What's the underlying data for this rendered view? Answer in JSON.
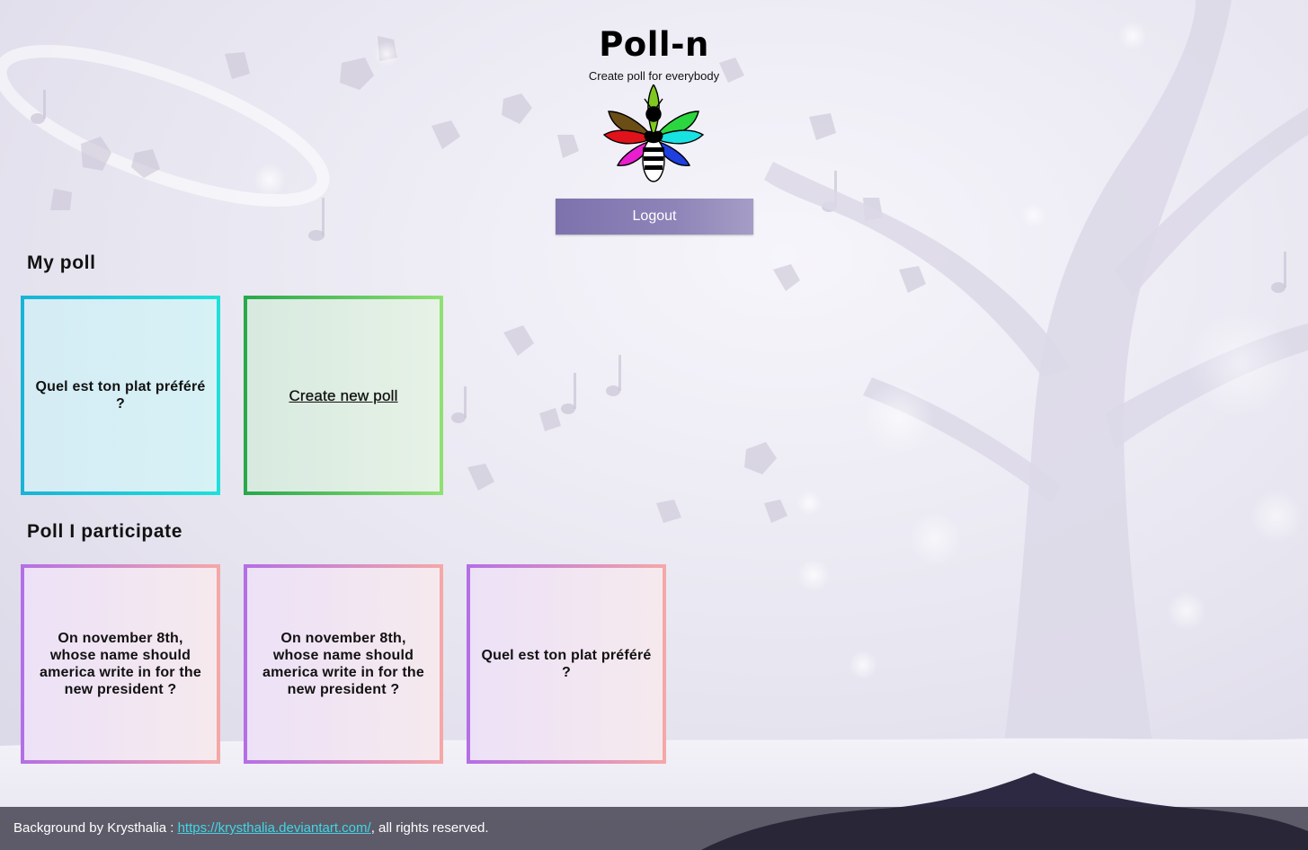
{
  "header": {
    "title": "Poll-n",
    "subtitle": "Create poll for everybody",
    "logout_label": "Logout"
  },
  "my_polls": {
    "title": "My poll",
    "cards": [
      {
        "label": "Quel est ton plat préféré ?"
      }
    ],
    "create_label": "Create new poll"
  },
  "participated": {
    "title": "Poll I participate",
    "cards": [
      {
        "label": "On november 8th, whose name should america write in for the new president ?"
      },
      {
        "label": "On november 8th, whose name should america write in for the new president ?"
      },
      {
        "label": "Quel est ton plat préféré ?"
      }
    ]
  },
  "footer": {
    "prefix": "Background by Krysthalia : ",
    "link_text": "https://krysthalia.deviantart.com/",
    "suffix": ", all rights reserved."
  },
  "colors": {
    "logout_bg": "#8a7fb5",
    "my_poll_border": "#19b3d6",
    "create_border": "#27a84a",
    "participate_border_start": "#b46ee6",
    "participate_border_end": "#f5a8a8",
    "footer_link": "#3fd6e6"
  }
}
